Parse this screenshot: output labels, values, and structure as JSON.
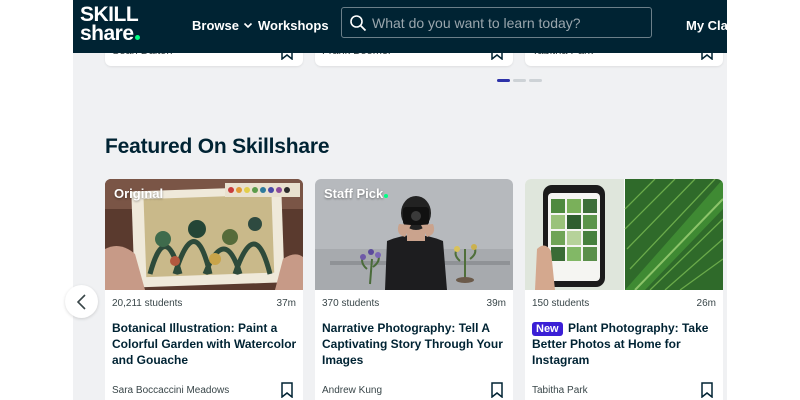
{
  "header": {
    "logo_line1": "SKILL",
    "logo_line2": "share",
    "browse_label": "Browse",
    "workshops_label": "Workshops",
    "search_placeholder": "What do you want to learn today?",
    "my_classes_label": "My Cla",
    "background_color": "#002333",
    "brand_accent": "#00ff84"
  },
  "previous_row": {
    "authors": [
      "Sean Dalton",
      "Frank Boomer",
      "Tabitha Park"
    ],
    "pagination": {
      "pages": 3,
      "active_index": 0
    }
  },
  "featured": {
    "title": "Featured On Skillshare",
    "cards": [
      {
        "label": "Original",
        "students": "20,211 students",
        "duration": "37m",
        "badge": "",
        "title": "Botanical Illustration: Paint a Colorful Garden with Watercolor and Gouache",
        "author": "Sara Boccaccini Meadows"
      },
      {
        "label": "Staff Pick",
        "students": "370 students",
        "duration": "39m",
        "badge": "",
        "title": "Narrative Photography: Tell A Captivating Story Through Your Images",
        "author": "Andrew Kung"
      },
      {
        "label": "",
        "students": "150 students",
        "duration": "26m",
        "badge": "New",
        "title": "Plant Photography: Take Better Photos at Home for Instagram",
        "author": "Tabitha Park"
      }
    ]
  },
  "icons": {
    "search": "search-icon",
    "bookmark": "bookmark-icon",
    "chevron_down": "chevron-down-icon",
    "carousel_prev": "chevron-left-icon"
  },
  "colors": {
    "badge_new": "#3b1fd6",
    "pagination_active": "#2d32a8"
  }
}
